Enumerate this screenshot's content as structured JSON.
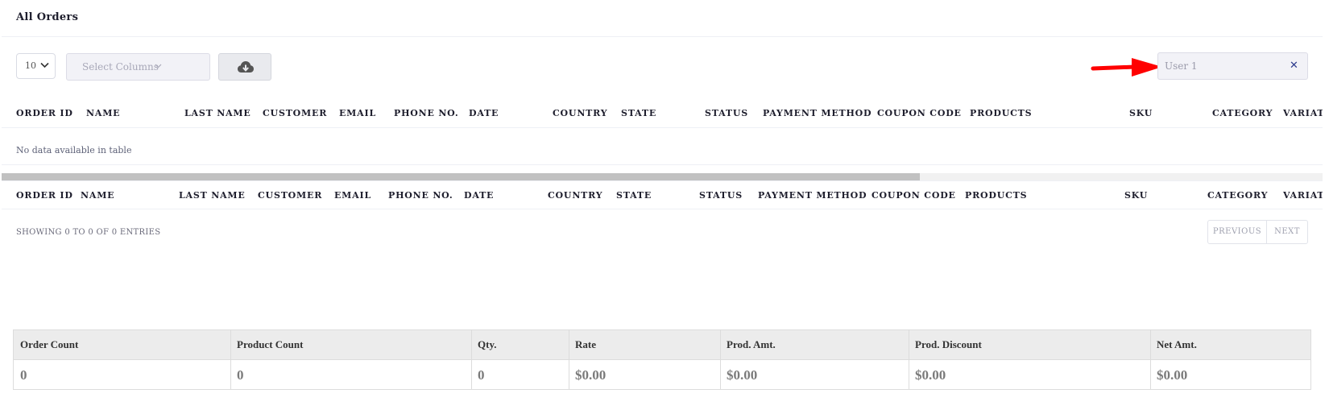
{
  "panel": {
    "title": "All Orders"
  },
  "toolbar": {
    "page_length": "10",
    "select_columns_placeholder": "Select Columns",
    "download_icon": "cloud-download-icon",
    "search_value": "User 1",
    "clear_symbol": "✕"
  },
  "annotation": {
    "arrow_color": "#ff0000"
  },
  "table": {
    "columns": [
      "ORDER ID",
      "NAME",
      "LAST NAME",
      "CUSTOMER",
      "EMAIL",
      "PHONE NO.",
      "DATE",
      "COUNTRY",
      "STATE",
      "STATUS",
      "PAYMENT METHOD",
      "COUPON CODE",
      "PRODUCTS",
      "SKU",
      "CATEGORY",
      "VARIATI"
    ],
    "empty_message": "No data available in table",
    "info": "SHOWING 0 TO 0 OF 0 ENTRIES",
    "pagination": {
      "previous": "PREVIOUS",
      "next": "NEXT"
    }
  },
  "summary": {
    "headers": [
      "Order Count",
      "Product Count",
      "Qty.",
      "Rate",
      "Prod. Amt.",
      "Prod. Discount",
      "Net Amt."
    ],
    "values": [
      "0",
      "0",
      "0",
      "$0.00",
      "$0.00",
      "$0.00",
      "$0.00"
    ]
  }
}
